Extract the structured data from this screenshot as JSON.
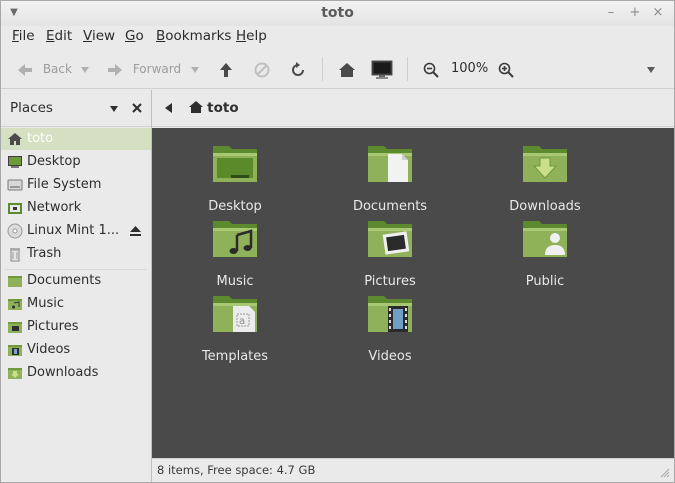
{
  "window": {
    "title": "toto"
  },
  "menubar": [
    {
      "label": "File",
      "u": "F",
      "rest": "ile"
    },
    {
      "label": "Edit",
      "u": "E",
      "rest": "dit"
    },
    {
      "label": "View",
      "u": "V",
      "rest": "iew"
    },
    {
      "label": "Go",
      "u": "G",
      "rest": "o"
    },
    {
      "label": "Bookmarks",
      "u": "B",
      "rest": "ookmarks"
    },
    {
      "label": "Help",
      "u": "H",
      "rest": "elp"
    }
  ],
  "toolbar": {
    "back_label": "Back",
    "forward_label": "Forward",
    "zoom_level": "100%",
    "icons": [
      "back-arrow-icon",
      "forward-arrow-icon",
      "up-arrow-icon",
      "stop-icon",
      "reload-icon",
      "home-icon",
      "computer-icon",
      "zoom-out-icon",
      "zoom-in-icon",
      "overflow-arrow-icon"
    ]
  },
  "sidebar": {
    "header": "Places",
    "places": [
      {
        "label": "toto",
        "icon": "home-icon",
        "selected": true
      },
      {
        "label": "Desktop",
        "icon": "desktop-icon"
      },
      {
        "label": "File System",
        "icon": "harddisk-icon"
      },
      {
        "label": "Network",
        "icon": "network-icon"
      },
      {
        "label": "Linux Mint 1...",
        "icon": "cdrom-icon"
      },
      {
        "label": "Trash",
        "icon": "trash-icon"
      }
    ],
    "bookmarks": [
      {
        "label": "Documents",
        "icon": "folder-icon"
      },
      {
        "label": "Music",
        "icon": "folder-music-icon"
      },
      {
        "label": "Pictures",
        "icon": "folder-pictures-icon"
      },
      {
        "label": "Videos",
        "icon": "folder-videos-icon"
      },
      {
        "label": "Downloads",
        "icon": "folder-downloads-icon"
      }
    ]
  },
  "pathbar": {
    "current": "toto"
  },
  "files": [
    {
      "label": "Desktop",
      "emblem": "desktop"
    },
    {
      "label": "Documents",
      "emblem": "document"
    },
    {
      "label": "Downloads",
      "emblem": "download"
    },
    {
      "label": "Music",
      "emblem": "music"
    },
    {
      "label": "Pictures",
      "emblem": "pictures"
    },
    {
      "label": "Public",
      "emblem": "public"
    },
    {
      "label": "Templates",
      "emblem": "templates"
    },
    {
      "label": "Videos",
      "emblem": "videos"
    }
  ],
  "status": {
    "text": "8 items, Free space: 4.7 GB"
  },
  "colors": {
    "accent": "#8fb15a",
    "selection": "#d4e0c1",
    "main_bg": "#4a4a4a"
  }
}
